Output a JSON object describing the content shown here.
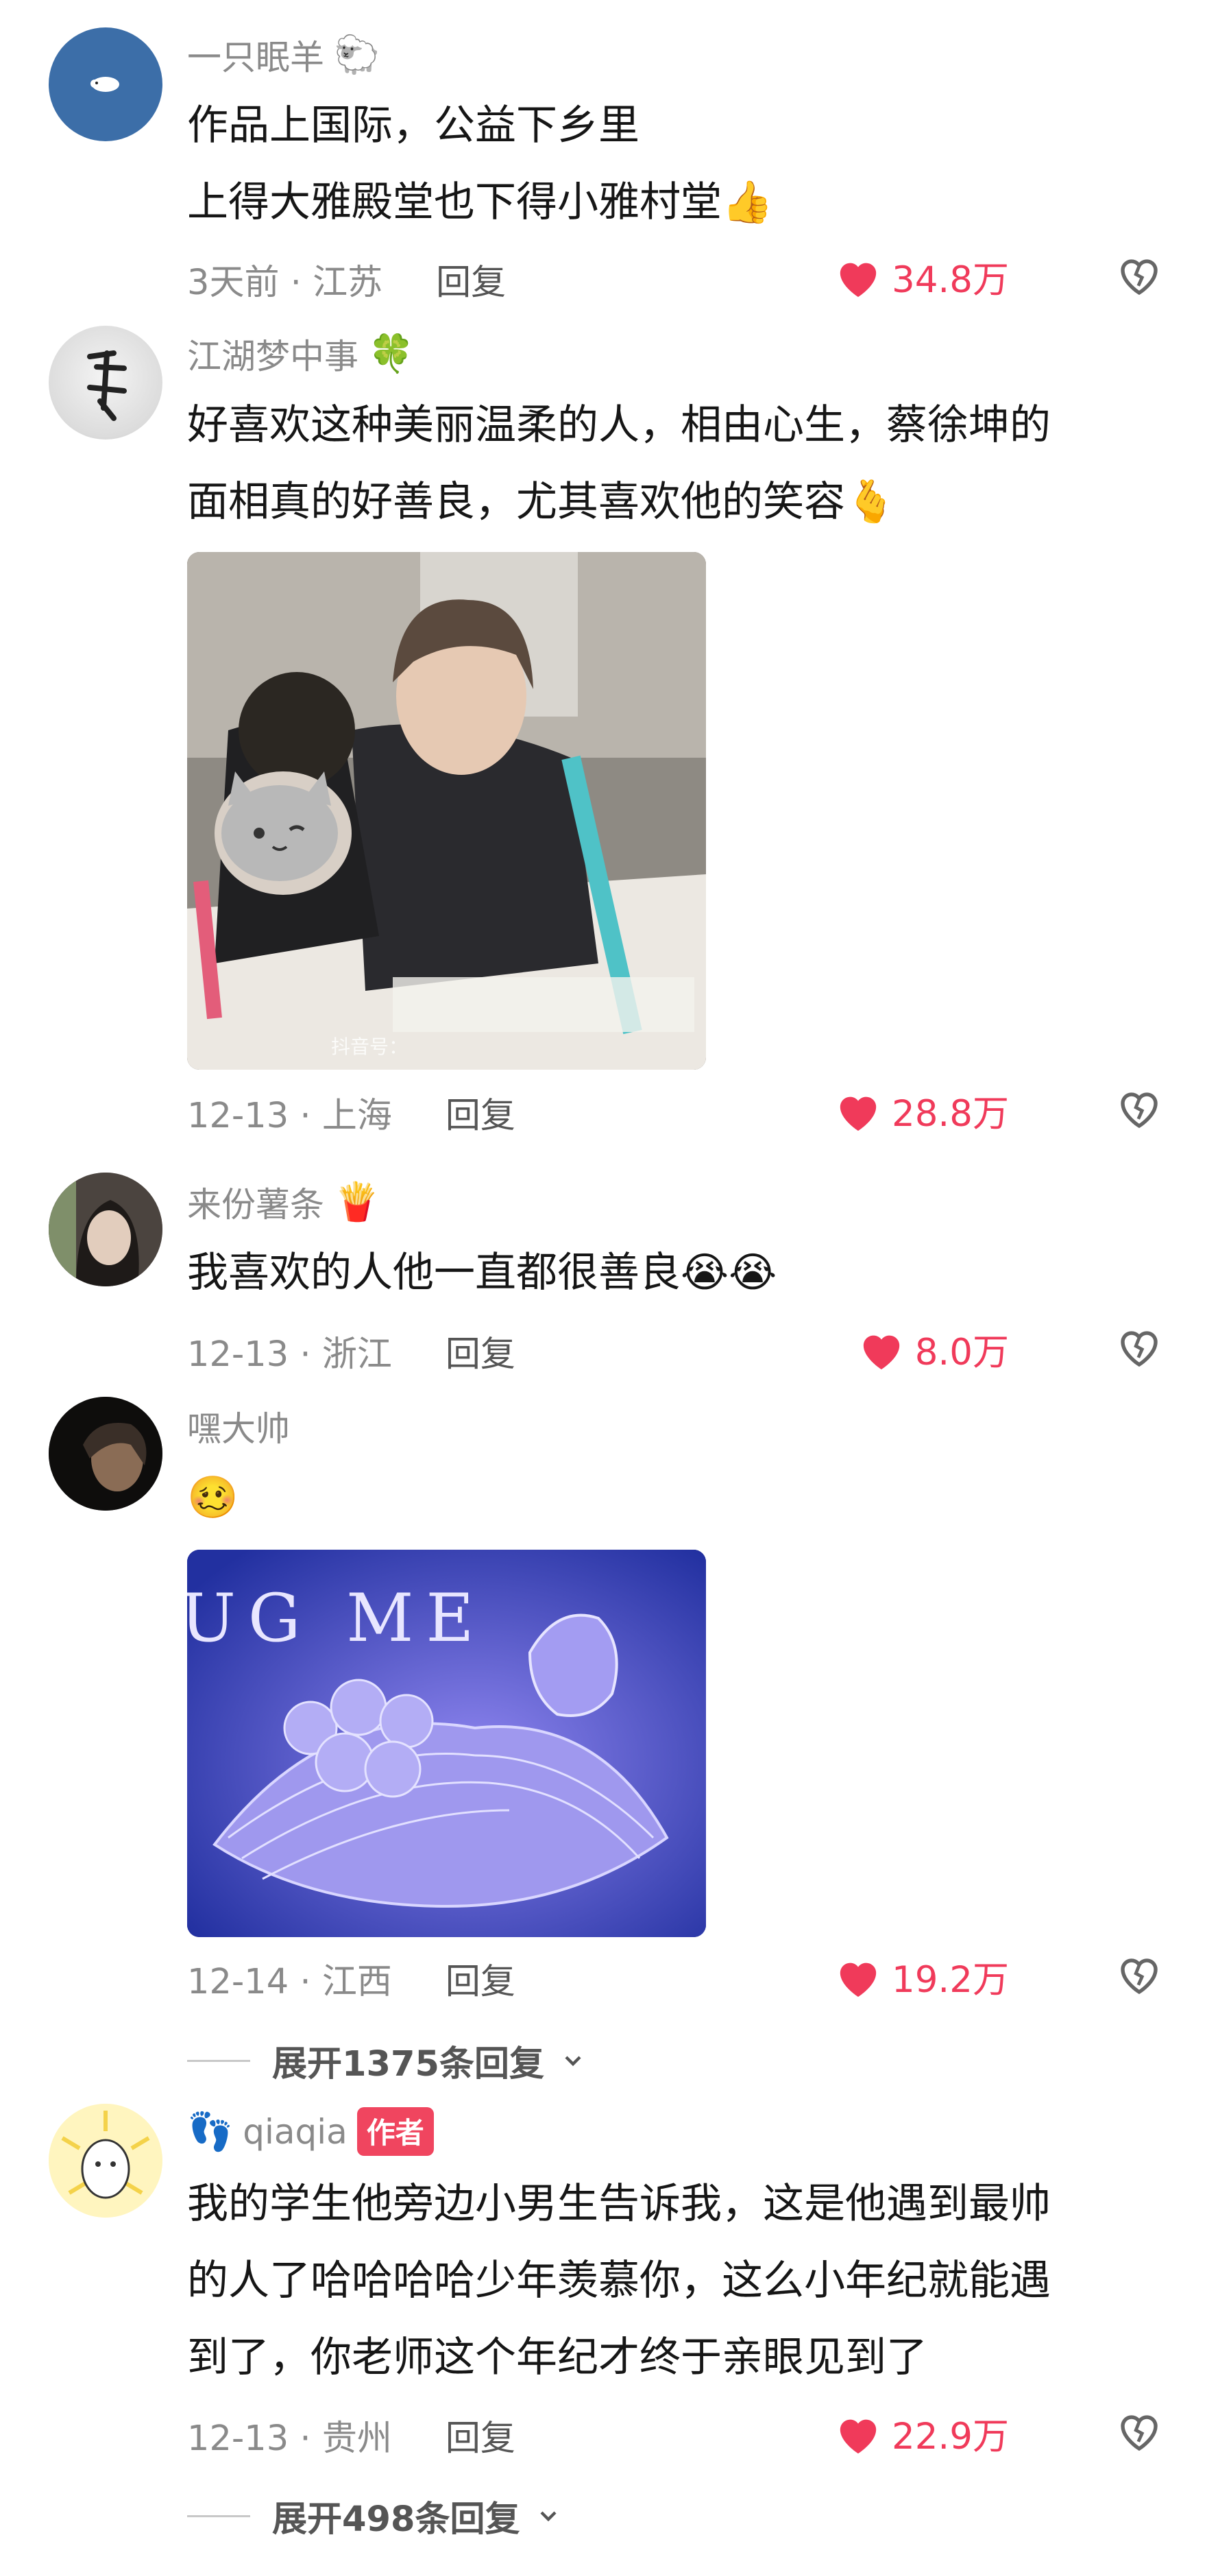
{
  "comments": [
    {
      "username": "一只眠羊",
      "username_emoji": "🐑",
      "lines": [
        "作品上国际，公益下乡里",
        "上得大雅殿堂也下得小雅村堂"
      ],
      "line_emoji": "👍",
      "time": "3天前 · 江苏",
      "reply": "回复",
      "likes": "34.8万"
    },
    {
      "username": "江湖梦中事",
      "username_emoji": "🍀",
      "lines": [
        "好喜欢这种美丽温柔的人，相由心生，蔡徐坤的",
        "面相真的好善良，尤其喜欢他的笑容"
      ],
      "line_emoji": "🫰",
      "image_watermark": "抖音号：",
      "time": "12-13 · 上海",
      "reply": "回复",
      "likes": "28.8万"
    },
    {
      "username": "来份薯条",
      "username_emoji": "🍟",
      "lines": [
        "我喜欢的人他一直都很善良"
      ],
      "line_emoji": "😭😭",
      "time": "12-13 · 浙江",
      "reply": "回复",
      "likes": "8.0万"
    },
    {
      "username": "嘿大帅",
      "username_emoji": "",
      "lines": [],
      "line_emoji": "🥴",
      "image_text": "UG ME",
      "time": "12-14 · 江西",
      "reply": "回复",
      "likes": "19.2万",
      "expand": "展开1375条回复"
    },
    {
      "username_prefix_emoji": "👣",
      "username": "qiaqia",
      "author_badge": "作者",
      "lines": [
        "我的学生他旁边小男生告诉我，这是他遇到最帅",
        "的人了哈哈哈哈少年羡慕你，这么小年纪就能遇",
        "到了，你老师这个年纪才终于亲眼见到了"
      ],
      "time": "12-13 · 贵州",
      "reply": "回复",
      "likes": "22.9万",
      "expand": "展开498条回复"
    }
  ],
  "colors": {
    "like": "#f03a5a",
    "meta": "#8a8a8a",
    "badge": "#f0455f"
  }
}
